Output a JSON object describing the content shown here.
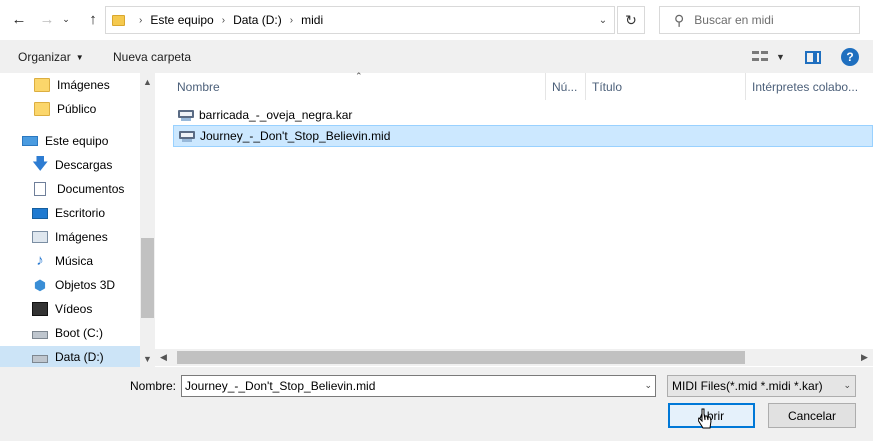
{
  "address_bar": {
    "back_icon": "back-arrow-icon",
    "forward_icon": "forward-arrow-icon",
    "recent_icon": "chevron-down-icon",
    "up_icon": "up-arrow-icon",
    "breadcrumbs": [
      "Este equipo",
      "Data (D:)",
      "midi"
    ],
    "search_placeholder": "Buscar en midi"
  },
  "toolbar": {
    "organize_label": "Organizar",
    "new_folder_label": "Nueva carpeta"
  },
  "nav_pane": {
    "items": [
      {
        "label": "Imágenes",
        "icon": "folder-icon"
      },
      {
        "label": "Público",
        "icon": "folder-icon"
      },
      {
        "label": "Este equipo",
        "icon": "computer-icon"
      },
      {
        "label": "Descargas",
        "icon": "download-icon"
      },
      {
        "label": "Documentos",
        "icon": "documents-icon"
      },
      {
        "label": "Escritorio",
        "icon": "desktop-icon"
      },
      {
        "label": "Imágenes",
        "icon": "pictures-icon"
      },
      {
        "label": "Música",
        "icon": "music-icon"
      },
      {
        "label": "Objetos 3D",
        "icon": "3d-objects-icon"
      },
      {
        "label": "Vídeos",
        "icon": "videos-icon"
      },
      {
        "label": "Boot (C:)",
        "icon": "drive-icon"
      },
      {
        "label": "Data (D:)",
        "icon": "drive-icon"
      }
    ],
    "selected_item": "Data (D:)"
  },
  "file_list": {
    "columns": [
      "Nombre",
      "Nú...",
      "Título",
      "Intérpretes colabo..."
    ],
    "files": [
      {
        "name": "barricada_-_oveja_negra.kar",
        "icon": "midi-file-icon"
      },
      {
        "name": "Journey_-_Don't_Stop_Believin.mid",
        "icon": "midi-file-icon"
      }
    ],
    "selected_file": "Journey_-_Don't_Stop_Believin.mid"
  },
  "footer": {
    "filename_label": "Nombre:",
    "filename_value": "Journey_-_Don't_Stop_Believin.mid",
    "filter_value": "MIDI Files(*.mid *.midi *.kar)",
    "open_label": "Abrir",
    "cancel_label": "Cancelar"
  },
  "colors": {
    "selection_bg": "#cce8ff",
    "selection_border": "#99d1ff",
    "accent": "#0078d7"
  }
}
